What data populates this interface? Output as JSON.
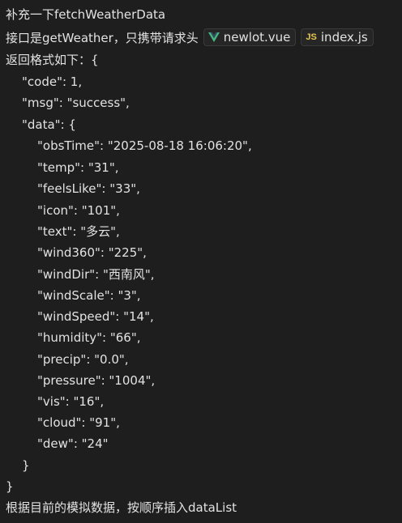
{
  "message": {
    "line1": "补充一下fetchWeatherData",
    "line2_prefix": "接口是getWeather，只携带请求头",
    "attachments": [
      {
        "name": "newlot.vue",
        "icon": "vue-icon",
        "icon_color": "#41b883"
      },
      {
        "name": "index.js",
        "icon": "js-icon",
        "icon_text": "JS",
        "icon_color": "#e8c84a"
      }
    ],
    "line3": "返回格式如下：{",
    "json_lines": [
      "\"code\": 1,",
      "\"msg\": \"success\",",
      "\"data\": {",
      "\"obsTime\": \"2025-08-18 16:06:20\",",
      "\"temp\": \"31\",",
      "\"feelsLike\": \"33\",",
      "\"icon\": \"101\",",
      "\"text\": \"多云\",",
      "\"wind360\": \"225\",",
      "\"windDir\": \"西南风\",",
      "\"windScale\": \"3\",",
      "\"windSpeed\": \"14\",",
      "\"humidity\": \"66\",",
      "\"precip\": \"0.0\",",
      "\"pressure\": \"1004\",",
      "\"vis\": \"16\",",
      "\"cloud\": \"91\",",
      "\"dew\": \"24\"",
      "}",
      "}"
    ],
    "last_line": "根据目前的模拟数据，按顺序插入dataList"
  },
  "colors": {
    "background": "#1e1e1e",
    "text": "#e2e2e2",
    "chip_border": "#3a3a3a",
    "chip_bg": "#262626"
  }
}
